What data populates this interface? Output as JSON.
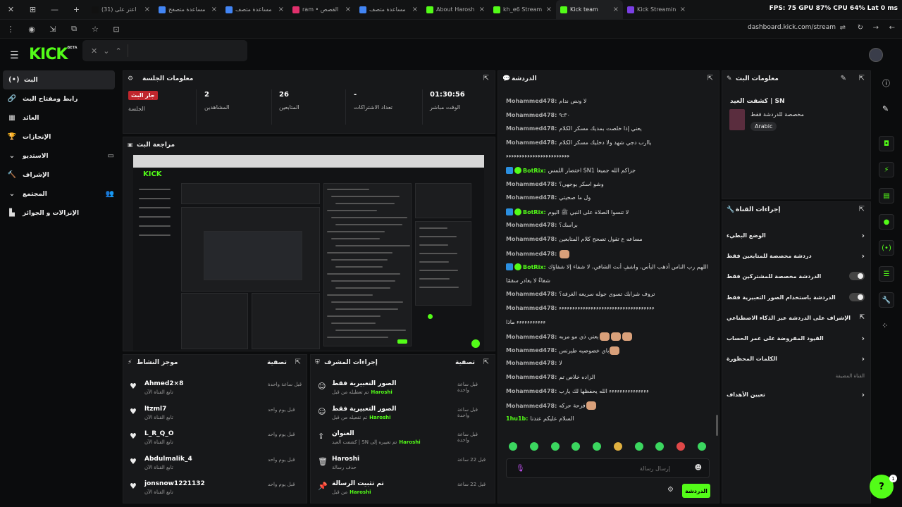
{
  "browser": {
    "tabs": [
      {
        "label": "(31) اعتر على",
        "color": "#111111"
      },
      {
        "label": "مساعدة متصفح",
        "color": "#4285f4"
      },
      {
        "label": "مساعدة متصف",
        "color": "#4285f4"
      },
      {
        "label": "ram • القصص",
        "color": "#e1306c"
      },
      {
        "label": "مساعدة متصف",
        "color": "#4285f4"
      },
      {
        "label": "About Harosh",
        "color": "#53fc18"
      },
      {
        "label": "kh_e6 Stream",
        "color": "#53fc18"
      },
      {
        "label": "Kick team",
        "color": "#53fc18"
      },
      {
        "label": "Kick Streamin",
        "color": "#7b3fe4"
      }
    ],
    "perf": "FPS: 75   GPU 87%   CPU 64%   Lat 0 ms",
    "url": "dashboard.kick.com/stream"
  },
  "logo": {
    "text": "KICK",
    "beta": "BETA"
  },
  "sidebar": [
    {
      "label": "البث",
      "icon": "(•)",
      "active": true
    },
    {
      "label": "رابط ومفتاح البث",
      "icon": "🔗"
    },
    {
      "label": "العائد",
      "icon": "▦"
    },
    {
      "label": "الإنجازات",
      "icon": "🏆"
    },
    {
      "label": "الاستديو",
      "icon": "⌄",
      "right": "▭"
    },
    {
      "label": "الإشراف",
      "icon": "🔨"
    },
    {
      "label": "المجتمع",
      "icon": "⌄",
      "right": "👥"
    },
    {
      "label": "الإنزالات و الجوائز",
      "icon": "▙"
    }
  ],
  "session": {
    "title": "معلومات الجلسة",
    "live_badge": "جار البث",
    "session_label": "الجلسة",
    "viewers": "2",
    "viewers_label": "المشاهدين",
    "followers": "26",
    "followers_label": "المتابعين",
    "subs": "-",
    "subs_label": "تعداد الاشتراكات",
    "uptime": "01:30:56",
    "uptime_label": "الوقت مباشر"
  },
  "preview": {
    "title": "مراجعة البث"
  },
  "activity": {
    "title": "موجز النشاط",
    "filter": "تصفية",
    "rows": [
      {
        "name": "Ahmed2×8",
        "sub": "تابع القناة الآن",
        "time": "قبل ساعة واحدة"
      },
      {
        "name": "ltzml7",
        "sub": "تابع القناة الآن",
        "time": "قبل يوم واحد"
      },
      {
        "name": "L_R_Q_O",
        "sub": "تابع القناة الآن",
        "time": "قبل يوم واحد"
      },
      {
        "name": "Abdulmalik_4",
        "sub": "تابع القناة الآن",
        "time": "قبل يوم واحد"
      },
      {
        "name": "jonsnow1221132",
        "sub": "تابع القناة الآن",
        "time": "قبل يوم واحد"
      }
    ]
  },
  "modactions": {
    "title": "إجراءات المشرف",
    "filter": "تصفية",
    "rows": [
      {
        "icon": "☺",
        "name": "الصور التعبيرية فقط",
        "sub": "تم تعطيله من قبل",
        "user": "Haroshi",
        "time": "قبل ساعة واحدة"
      },
      {
        "icon": "☺",
        "name": "الصور التعبيرية فقط",
        "sub": "تم تفعيله من قبل",
        "user": "Haroshi",
        "time": "قبل ساعة واحدة"
      },
      {
        "icon": "⇪",
        "name": "العنوان",
        "sub": "كشفت العيد | SN تم تغييره إلى",
        "user": "Haroshi",
        "time": "قبل ساعة واحدة"
      },
      {
        "icon": "🗑",
        "name": "Haroshi",
        "sub": "حذف رسالة",
        "user": "",
        "time": "قبل 22 ساعة"
      },
      {
        "icon": "📌",
        "name": "تم تثبيت الرسالة",
        "sub": "من قبل",
        "user": "Haroshi",
        "time": "قبل 22 ساعة"
      }
    ]
  },
  "chat": {
    "title": "الدردشة",
    "messages": [
      {
        "user": "Mohammed478:",
        "text": "لا ونص ندام"
      },
      {
        "user": "Mohammed478:",
        "text": "٩:٣٠"
      },
      {
        "user": "Mohammed478:",
        "text": "يعني إذا خلصت بمديك مسكر الكلام"
      },
      {
        "user": "Mohammed478:",
        "text": "ياارب دجي شهد ولا دخليك مسكر الكلام"
      },
      {
        "user": "",
        "text": "ءءءءءءءءءءءءءءءءءءءءءءءء"
      },
      {
        "user": "BotRix:",
        "text": "اختصار اللمس SN1 جزاكم الله جميعا",
        "bot": true
      },
      {
        "user": "Mohammed478:",
        "text": "وشو اسكر يوجهي؟"
      },
      {
        "user": "Mohammed478:",
        "text": "ول ما صحيتي"
      },
      {
        "user": "BotRix:",
        "text": "لا تنسوا الصلاة على النبي ﷺ اليوم",
        "bot": true
      },
      {
        "user": "Mohammed478:",
        "text": "برأسك؟"
      },
      {
        "user": "Mohammed478:",
        "text": "مساعه ع تقول تصحح كلام المتابعين"
      },
      {
        "user": "Mohammed478:",
        "text": "",
        "emotes": 1
      },
      {
        "user": "BotRix:",
        "text": "اللهم رب الناس أذهب البأس، واشفِ أنت الشافي، لا شفاء إلا شفاؤك",
        "bot": true
      },
      {
        "user": "",
        "text": "شفاءً لا يغادر سقمًا"
      },
      {
        "user": "Mohammed478:",
        "text": "تروف شرابك تسوي جوله سريعه الغرفة؟"
      },
      {
        "user": "Mohammed478:",
        "text": "ءءءءءءءءءءءءءءءءءءءءءءءءءءءءءءءءءءءء"
      },
      {
        "user": "",
        "text": "ءءءءءءءءءءء ماذا"
      },
      {
        "user": "Mohammed478:",
        "text": "يعني ذي مو مربه",
        "emotes": 3
      },
      {
        "user": "Mohammed478:",
        "text": "باي خصوصيه طيرنس",
        "emotes": 1
      },
      {
        "user": "Mohammed478:",
        "text": "لا"
      },
      {
        "user": "Mohammed478:",
        "text": "الزاده خلاص تم"
      },
      {
        "user": "Mohammed478:",
        "text": "ءءءءءءءءءءءءءءء الله يحفظها لك يارب"
      },
      {
        "user": "Mohammed478:",
        "text": "فرحة حركه",
        "emotes": 1
      },
      {
        "user": "1hu1b:",
        "text": "السلام عليكم عندنا",
        "green": true
      }
    ],
    "placeholder": "إرسال رسالة",
    "send": "الدردشة"
  },
  "streaminfo": {
    "title": "معلومات البث",
    "stream_title": "كشفت العيد | SN",
    "category": "مخصصة للدردشة فقط",
    "language": "Arabic"
  },
  "quick": {
    "title": "إجراءات القناة",
    "rows": [
      {
        "label": "الوضع البطيء",
        "kind": "arrow"
      },
      {
        "label": "دردشة مخصصة للمتابعين فقط",
        "kind": "arrow"
      },
      {
        "label": "الدردشة مخصصة للمشتركين فقط",
        "kind": "toggle"
      },
      {
        "label": "الدردشة باستخدام الصور التعبيرية فقط",
        "kind": "toggle"
      },
      {
        "label": "الإشراف على الدردشة عبر الذكاء الاصطناعي",
        "kind": "ext"
      },
      {
        "label": "القيود المفروضة على عمر الحساب",
        "kind": "arrow"
      },
      {
        "label": "الكلمات المحظورة",
        "kind": "arrow"
      }
    ],
    "section": "القناة المضيفة",
    "host": "تعيين الأهداف"
  },
  "help_badge": "1"
}
